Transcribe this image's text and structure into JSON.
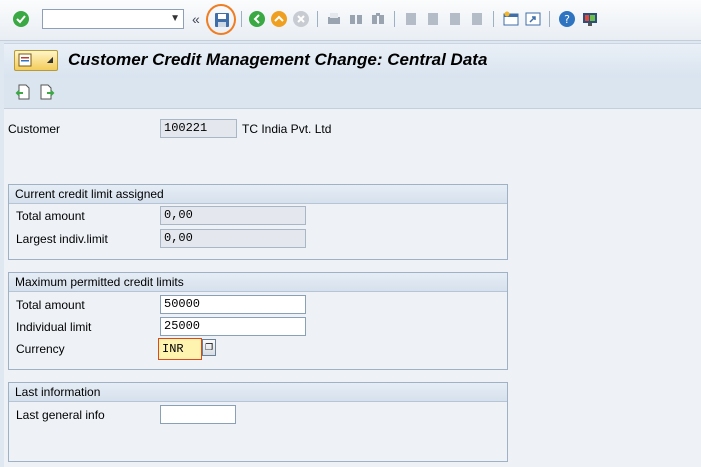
{
  "toolbar": {
    "command_field_value": "",
    "icons": [
      "check-icon",
      "save-icon",
      "back-icon",
      "exit-icon",
      "cancel-icon",
      "print-icon",
      "find-icon",
      "find-next-icon",
      "first-page-icon",
      "previous-page-icon",
      "next-page-icon",
      "last-page-icon",
      "create-session-icon",
      "shortcut-icon",
      "help-icon",
      "customize-layout-icon"
    ]
  },
  "header": {
    "title": "Customer Credit Management Change: Central Data"
  },
  "customer": {
    "label": "Customer",
    "number": "100221",
    "name": "TC India Pvt. Ltd"
  },
  "current_limit": {
    "title": "Current credit limit assigned",
    "total_amount_label": "Total amount",
    "total_amount_value": "0,00",
    "largest_limit_label": "Largest indiv.limit",
    "largest_limit_value": "0,00"
  },
  "max_limits": {
    "title": "Maximum permitted credit limits",
    "total_amount_label": "Total amount",
    "total_amount_value": "50000",
    "individual_limit_label": "Individual limit",
    "individual_limit_value": "25000",
    "currency_label": "Currency",
    "currency_value": "INR"
  },
  "last_info": {
    "title": "Last information",
    "general_info_label": "Last general info",
    "general_info_value": ""
  },
  "colors": {
    "save_highlight": "#f07d22",
    "title_bg": "#dbe5f0"
  }
}
